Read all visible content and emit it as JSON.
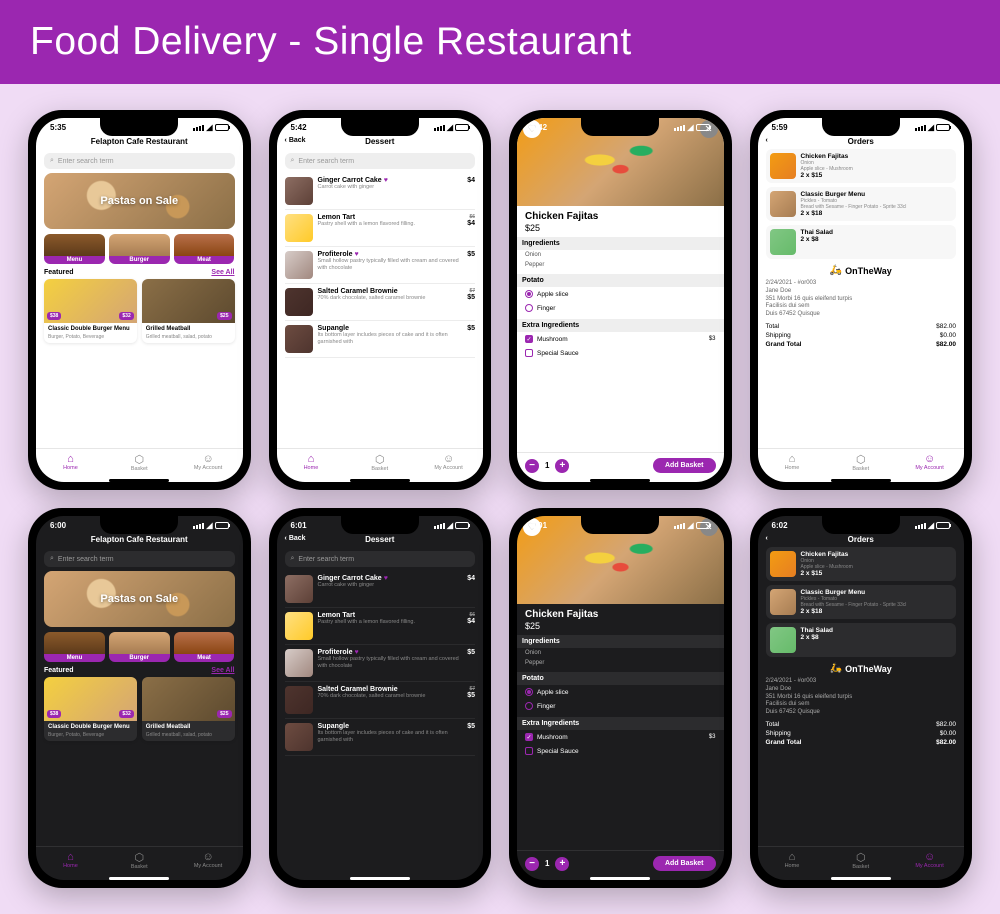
{
  "banner": "Food Delivery - Single Restaurant",
  "accent": "#9b27b0",
  "tabs": {
    "home": "Home",
    "basket": "Basket",
    "account": "My Account"
  },
  "home": {
    "time": "5:35",
    "title": "Felapton Cafe Restaurant",
    "search_ph": "Enter search term",
    "hero": "Pastas on Sale",
    "cats": [
      "Menu",
      "Burger",
      "Meat"
    ],
    "featured_label": "Featured",
    "see_all": "See All",
    "cards": [
      {
        "title": "Classic Double Burger Menu",
        "sub": "Burger, Potato, Beverage",
        "badge1": "$38",
        "badge2": "$32"
      },
      {
        "title": "Grilled Meatball",
        "sub": "Grilled meatball, salad, potato",
        "badge2": "$25"
      }
    ]
  },
  "dessert": {
    "time": "5:42",
    "back": "Back",
    "title": "Dessert",
    "search_ph": "Enter search term",
    "items": [
      {
        "t": "Ginger Carrot Cake",
        "d": "Carrot cake with ginger",
        "p": "$4",
        "fav": true
      },
      {
        "t": "Lemon Tart",
        "d": "Pastry shell with a lemon flavored filling.",
        "p": "$4",
        "old": "$6"
      },
      {
        "t": "Profiterole",
        "d": "Small hollow pastry typically filled with cream and covered with chocolate",
        "p": "$5",
        "fav": true
      },
      {
        "t": "Salted Caramel Brownie",
        "d": "70% dark chocolate, salted caramel brownie",
        "p": "$5",
        "old": "$7"
      },
      {
        "t": "Supangle",
        "d": "Its bottom layer includes pieces of cake and it is often garnished with",
        "p": "$5"
      }
    ]
  },
  "detail": {
    "time": "5:42",
    "title": "Chicken Fajitas",
    "price": "$25",
    "ingredients_label": "Ingredients",
    "ingredients": [
      "Onion",
      "Pepper"
    ],
    "potato_label": "Potato",
    "potato_opts": [
      {
        "l": "Apple slice",
        "on": true
      },
      {
        "l": "Finger",
        "on": false
      }
    ],
    "extra_label": "Extra Ingredients",
    "extras": [
      {
        "l": "Mushroom",
        "p": "$3",
        "on": true
      },
      {
        "l": "Special Sauce",
        "p": "",
        "on": false
      }
    ],
    "qty": "1",
    "add": "Add Basket"
  },
  "orders": {
    "time": "5:59",
    "title": "Orders",
    "items": [
      {
        "t": "Chicken Fajitas",
        "opt": "Onion",
        "d": "Apple slice - Mushroom",
        "q": "2 x $15"
      },
      {
        "t": "Classic Burger Menu",
        "opt": "Pickles - Tomato",
        "d": "Bread with Sesame - Finger Potato - Sprite 33cl",
        "q": "2 x $18"
      },
      {
        "t": "Thai Salad",
        "opt": "",
        "d": "",
        "q": "2 x $8"
      }
    ],
    "status": "OnTheWay",
    "date": "2/24/2021 - #or003",
    "addr": [
      "Jane Doe",
      "351 Morbi 16 quis eleifend turpis",
      "Facilisis dui sem",
      "Duis 67452 Quisque"
    ],
    "totals": [
      {
        "l": "Total",
        "v": "$82.00"
      },
      {
        "l": "Shipping",
        "v": "$0.00"
      },
      {
        "l": "Grand Total",
        "v": "$82.00"
      }
    ]
  },
  "dark_times": {
    "home": "6:00",
    "dessert": "6:01",
    "detail": "6:01",
    "orders": "6:02"
  }
}
